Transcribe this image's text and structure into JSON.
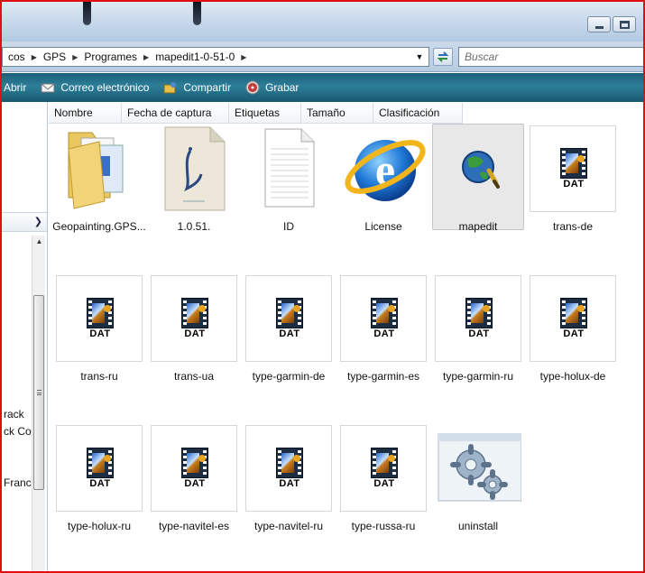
{
  "window": {
    "controls": {
      "minimize_icon": "minimize-icon",
      "maximize_icon": "maximize-icon"
    }
  },
  "address": {
    "crumbs": [
      "cos",
      "GPS",
      "Programes",
      "mapedit1-0-51-0"
    ],
    "search_placeholder": "Buscar"
  },
  "commands": [
    {
      "label": "Abrir",
      "icon": "open-icon"
    },
    {
      "label": "Correo electrónico",
      "icon": "email-icon"
    },
    {
      "label": "Compartir",
      "icon": "share-icon"
    },
    {
      "label": "Grabar",
      "icon": "burn-icon"
    }
  ],
  "columns": [
    "Nombre",
    "Fecha de captura",
    "Etiquetas",
    "Tamaño",
    "Clasificación"
  ],
  "nav": {
    "partial_items": [
      "rack",
      "ck Co",
      "Franc"
    ]
  },
  "files": [
    {
      "name": "Geopainting.GPS...",
      "icon": "folder-icon"
    },
    {
      "name": "1.0.51.",
      "icon": "text-document-icon"
    },
    {
      "name": "ID",
      "icon": "blank-document-icon"
    },
    {
      "name": "License",
      "icon": "internet-explorer-icon"
    },
    {
      "name": "mapedit",
      "icon": "mapedit-globe-icon",
      "selected": true
    },
    {
      "name": "trans-de",
      "icon": "dat-file-icon"
    },
    {
      "name": "trans-ru",
      "icon": "dat-file-icon"
    },
    {
      "name": "trans-ua",
      "icon": "dat-file-icon"
    },
    {
      "name": "type-garmin-de",
      "icon": "dat-file-icon"
    },
    {
      "name": "type-garmin-es",
      "icon": "dat-file-icon"
    },
    {
      "name": "type-garmin-ru",
      "icon": "dat-file-icon"
    },
    {
      "name": "type-holux-de",
      "icon": "dat-file-icon"
    },
    {
      "name": "type-holux-ru",
      "icon": "dat-file-icon"
    },
    {
      "name": "type-navitel-es",
      "icon": "dat-file-icon"
    },
    {
      "name": "type-navitel-ru",
      "icon": "dat-file-icon"
    },
    {
      "name": "type-russa-ru",
      "icon": "dat-file-icon"
    },
    {
      "name": "uninstall",
      "icon": "settings-gears-icon"
    }
  ],
  "dat_badge": "DAT",
  "colors": {
    "command_bar": "#1a5f7a",
    "selection": "#e8e8e8",
    "frame_border": "#e01010"
  }
}
